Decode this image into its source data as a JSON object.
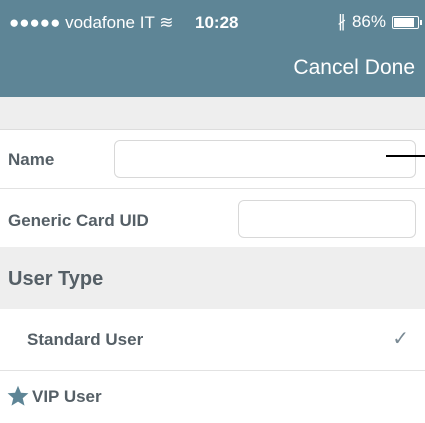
{
  "status_bar": {
    "carrier": "●●●●● vodafone IT ≋",
    "time": "10:28",
    "bluetooth": "∦",
    "battery_text": "86%",
    "battery_level": 0.86
  },
  "nav": {
    "cancel_label": "Cancel",
    "done_label": "Done"
  },
  "form": {
    "name_label": "Name",
    "name_value": "",
    "card_uid_label": "Generic Card UID",
    "card_uid_value": ""
  },
  "user_type": {
    "section_title": "User Type",
    "options": [
      {
        "label": "Standard User",
        "selected": true,
        "icon": ""
      },
      {
        "label": "VIP User",
        "selected": false,
        "icon": "star-icon"
      }
    ],
    "check_glyph": "✓"
  },
  "colors": {
    "header_bg": "#5e8596",
    "section_bg": "#eeeeee",
    "label_text": "#555f66"
  }
}
